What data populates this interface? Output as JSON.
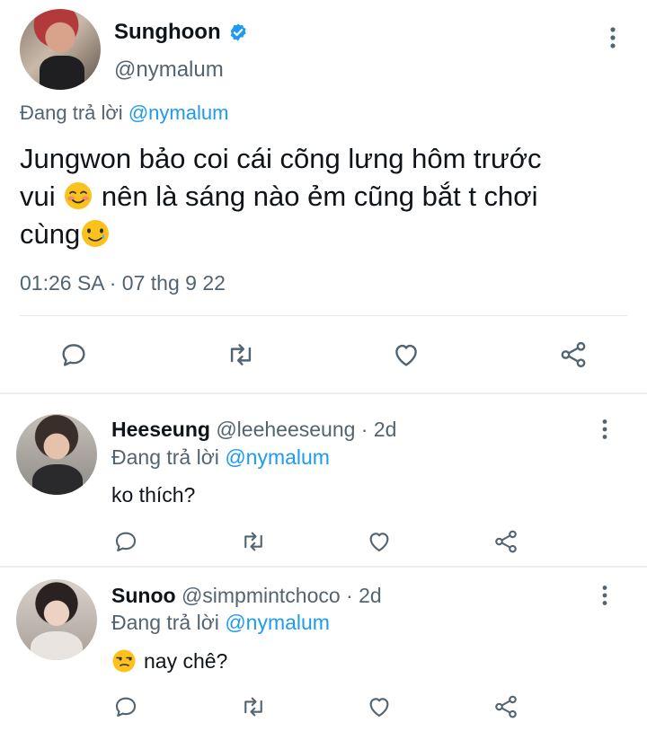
{
  "main_tweet": {
    "name": "Sunghoon",
    "handle": "@nymalum",
    "replying_prefix": "Đang trả lời ",
    "replying_mention": "@nymalum",
    "text_line1": "Jungwon bảo coi cái cõng lưng hôm trước",
    "text_line2a": "vui ",
    "text_line2b": " nên là sáng nào ẻm cũng bắt t chơi",
    "text_line3": "cùng",
    "emoji1": "smiling-face-with-blush",
    "emoji2": "smiling-face-with-tear",
    "timestamp": "01:26 SA · 07 thg 9 22",
    "verified": true
  },
  "replies": [
    {
      "name": "Heeseung",
      "handle": "@leeheeseung",
      "time": " · 2d",
      "replying_prefix": "Đang trả lời ",
      "replying_mention": "@nymalum",
      "text": "ko thích?"
    },
    {
      "name": "Sunoo",
      "handle": "@simpmintchoco",
      "time": " · 2d",
      "replying_prefix": "Đang trả lời ",
      "replying_mention": "@nymalum",
      "emoji": "unamused-face",
      "text": "nay chê?"
    }
  ],
  "colors": {
    "accent": "#1d9bf0",
    "secondary_text": "#536471",
    "primary_text": "#0f1419",
    "icon": "#536471"
  },
  "icons": [
    "reply-icon",
    "retweet-icon",
    "like-icon",
    "share-icon",
    "more-options-icon",
    "verified-badge-icon"
  ]
}
